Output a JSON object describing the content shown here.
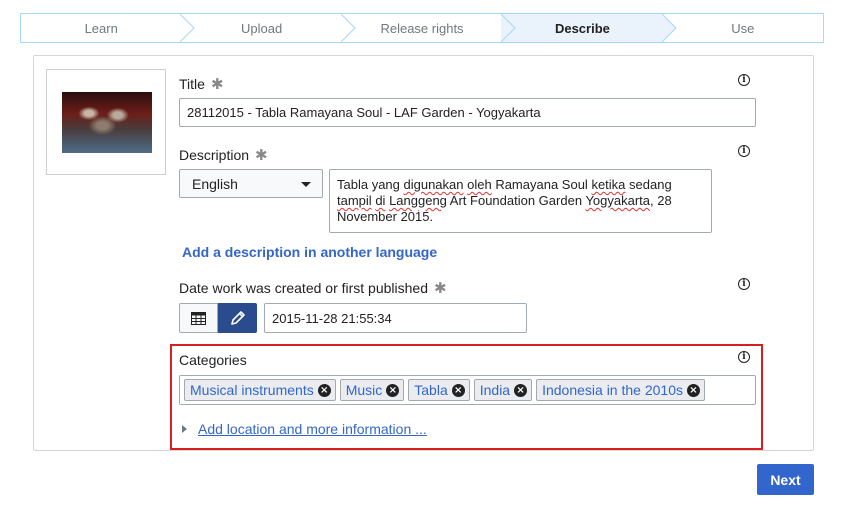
{
  "steps": [
    "Learn",
    "Upload",
    "Release rights",
    "Describe",
    "Use"
  ],
  "active_step": 3,
  "form": {
    "title_label": "Title",
    "required_mark": "✱",
    "title_value": "28112015 - Tabla Ramayana Soul - LAF Garden - Yogyakarta",
    "description_label": "Description",
    "language_selected": "English",
    "description_parts": [
      {
        "text": "Tabla yang ",
        "spell": false
      },
      {
        "text": "digunakan",
        "spell": true
      },
      {
        "text": " ",
        "spell": false
      },
      {
        "text": "oleh",
        "spell": true
      },
      {
        "text": " Ramayana Soul ",
        "spell": false
      },
      {
        "text": "ketika",
        "spell": true
      },
      {
        "text": " sedang ",
        "spell": false
      },
      {
        "text": "tampil",
        "spell": true
      },
      {
        "text": " ",
        "spell": false
      },
      {
        "text": "di",
        "spell": true
      },
      {
        "text": " ",
        "spell": false
      },
      {
        "text": "Langgeng",
        "spell": true
      },
      {
        "text": " Art Foundation Garden ",
        "spell": false
      },
      {
        "text": "Yogyakarta",
        "spell": true
      },
      {
        "text": ", 28 November 2015.",
        "spell": false
      }
    ],
    "add_description_link": "Add a description in another language",
    "date_label": "Date work was created or first published",
    "date_value": "2015-11-28 21:55:34",
    "categories_label": "Categories",
    "categories": [
      "Musical instruments",
      "Music",
      "Tabla",
      "India",
      "Indonesia in the 2010s"
    ],
    "add_location_link": "Add location and more information ..."
  },
  "next_button": "Next",
  "colors": {
    "accent": "#3366cc",
    "active_step_bg": "#eaf3fb",
    "highlight_border": "#d62020",
    "pencil_button": "#2a4b8d"
  },
  "icons": {
    "info": "info-icon",
    "calendar": "calendar-icon",
    "pencil": "pencil-icon",
    "remove": "remove-tag-icon",
    "expand": "expand-triangle-icon",
    "dropdown": "chevron-down-icon"
  }
}
